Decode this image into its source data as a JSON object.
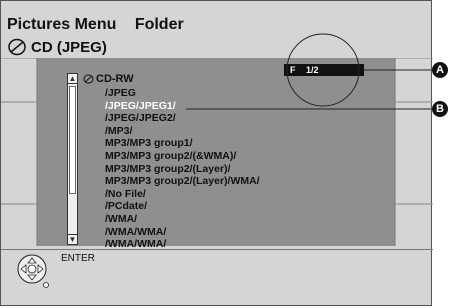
{
  "header": {
    "title": "Pictures Menu",
    "folder_label": "Folder",
    "disc_label": "CD (JPEG)"
  },
  "tree": {
    "root": "CD-RW",
    "folders": [
      {
        "label": "/JPEG"
      },
      {
        "label": "/JPEG/JPEG1/"
      },
      {
        "label": "/JPEG/JPEG2/"
      },
      {
        "label": "/MP3/"
      },
      {
        "label": "MP3/MP3 group1/"
      },
      {
        "label": "MP3/MP3 group2/(&WMA)/"
      },
      {
        "label": "MP3/MP3 group2/(Layer)/"
      },
      {
        "label": "MP3/MP3 group2/(Layer)/WMA/"
      },
      {
        "label": "/No File/"
      },
      {
        "label": "/PCdate/"
      },
      {
        "label": "/WMA/"
      },
      {
        "label": "/WMA/WMA/"
      },
      {
        "label": "/WMA/WMA/"
      }
    ],
    "selected_index": 1
  },
  "page_indicator": {
    "prefix": "F",
    "value": "1/2"
  },
  "footer": {
    "enter_label": "ENTER"
  },
  "callouts": {
    "a": "A",
    "b": "B"
  },
  "colors": {
    "screen_bg": "#d5d5d5",
    "panel_bg": "#8f8f8f",
    "selected_text": "#ffffff"
  }
}
